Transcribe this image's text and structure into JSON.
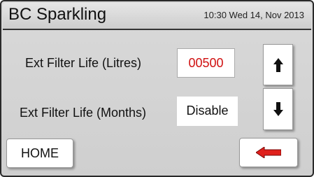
{
  "header": {
    "title": "BC Sparkling",
    "datetime": "10:30 Wed 14, Nov 2013"
  },
  "settings": {
    "litres_label": "Ext Filter Life (Litres)",
    "litres_value": "00500",
    "months_label": "Ext Filter Life (Months)",
    "months_value": "Disable"
  },
  "buttons": {
    "up_icon": "up-arrow-icon",
    "down_icon": "down-arrow-icon",
    "home_label": "HOME",
    "back_icon": "back-arrow-icon"
  },
  "colors": {
    "value_red": "#d01010",
    "back_arrow_red": "#e0201c"
  }
}
